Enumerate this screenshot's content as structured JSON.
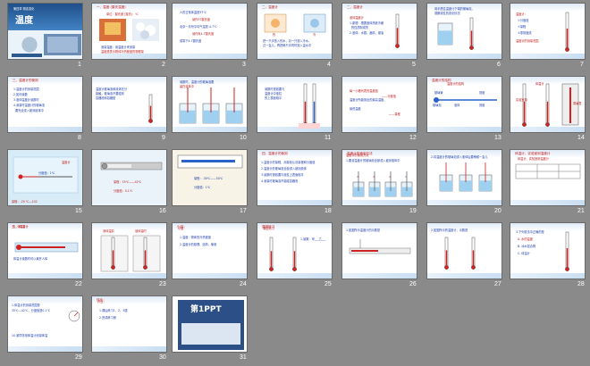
{
  "slides": [
    {
      "num": "1",
      "title": "温度",
      "subtitle": "第四章 物态变化"
    },
    {
      "num": "2",
      "head": "一、温度 (摄氏温度)",
      "lines": [
        "单位：摄氏度 (摄氏)：℃"
      ]
    },
    {
      "num": "3",
      "lines": [
        "人的正常体温是37℃",
        "读作37摄氏度",
        "北京一月份平均气温是-4.7℃",
        "读作负4.7摄氏度",
        "或零下4.7摄氏度"
      ]
    },
    {
      "num": "4",
      "head": "二、温度计"
    },
    {
      "num": "5",
      "head": "二、温度计"
    },
    {
      "num": "6"
    },
    {
      "num": "7"
    },
    {
      "num": "8",
      "head": "三、温度计的使用"
    },
    {
      "num": "9"
    },
    {
      "num": "10"
    },
    {
      "num": "11"
    },
    {
      "num": "12",
      "lines": [
        "每一小格代表的温度值",
        "温度计所能测出的最高温度、",
        "最低温度"
      ]
    },
    {
      "num": "13",
      "head": "温度计的结构"
    },
    {
      "num": "14",
      "lines": [
        "实验室用",
        "体温计",
        "寒暑表"
      ]
    },
    {
      "num": "15",
      "lines": [
        "温度计",
        "分度值：1℃",
        "量程：-20 ℃—102"
      ]
    },
    {
      "num": "16",
      "lines": [
        "量程：35℃——42℃",
        "分度值：0.1℃"
      ]
    },
    {
      "num": "17",
      "lines": [
        "量程：-30℃——50℃",
        "分度值：1℃"
      ]
    },
    {
      "num": "18",
      "head": "四、温度计的使用"
    },
    {
      "num": "19",
      "head": "温度计的使用方法"
    },
    {
      "num": "20"
    },
    {
      "num": "21",
      "head": "体温计、实验室用温度计"
    },
    {
      "num": "22",
      "head": "五、体温计"
    },
    {
      "num": "23",
      "lines": [
        "测体温前",
        "读体温时"
      ]
    },
    {
      "num": "24",
      "head": "小结："
    },
    {
      "num": "25",
      "head": "课堂练习"
    },
    {
      "num": "26"
    },
    {
      "num": "27"
    },
    {
      "num": "28"
    },
    {
      "num": "29"
    },
    {
      "num": "30",
      "head": "作业："
    },
    {
      "num": "31",
      "logo": "第1PPT"
    }
  ]
}
